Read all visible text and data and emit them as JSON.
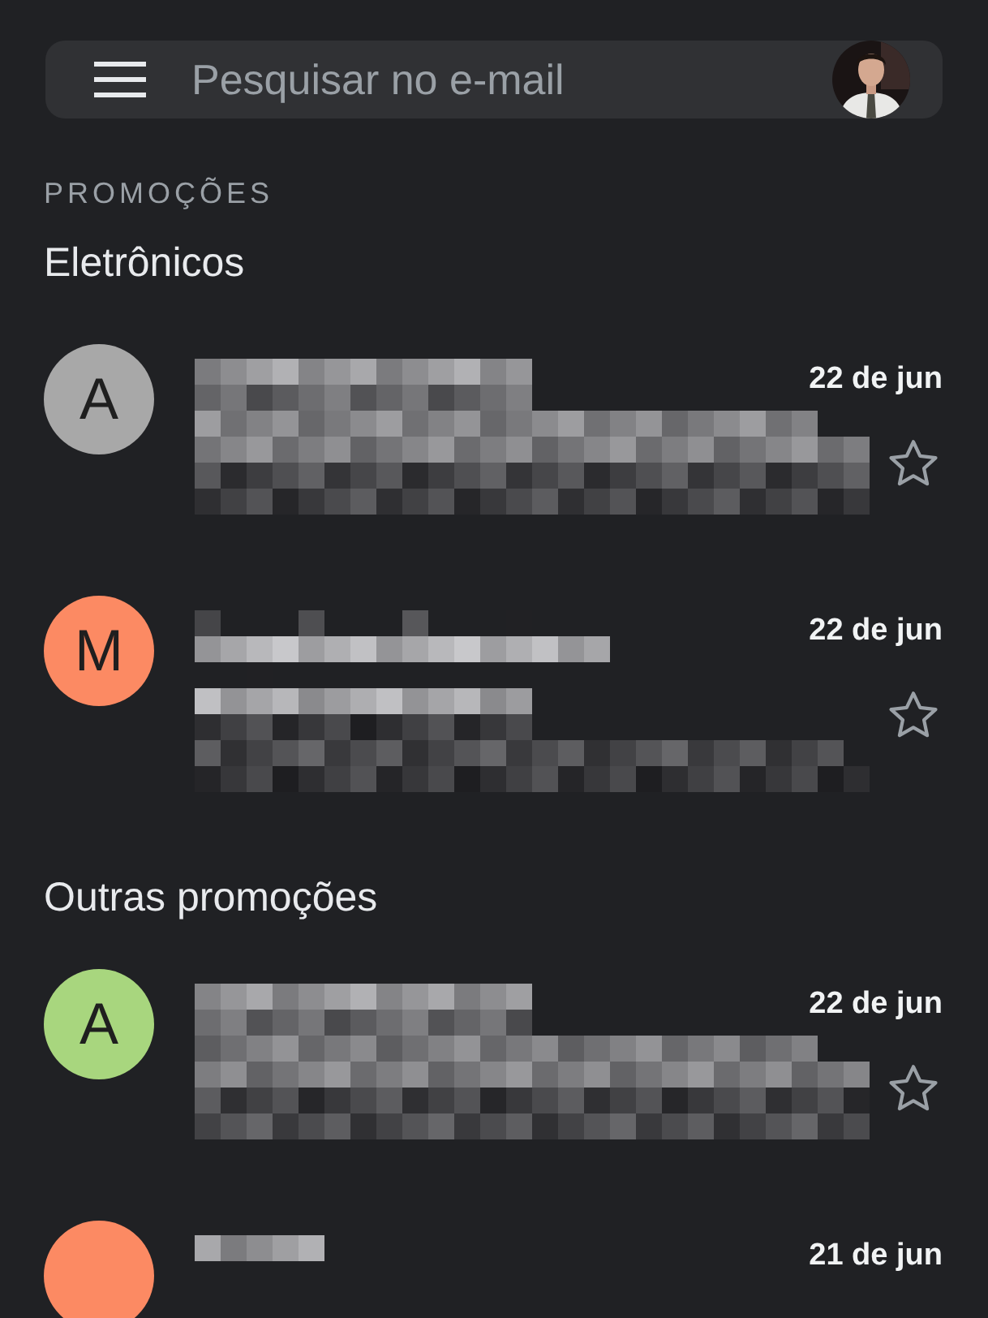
{
  "search": {
    "placeholder": "Pesquisar no e-mail"
  },
  "category_label": "PROMOÇÕES",
  "sections": [
    {
      "title": "Eletrônicos",
      "messages": [
        {
          "avatar_letter": "A",
          "color": "#a8a8a8",
          "date": "22 de jun",
          "starred": false
        },
        {
          "avatar_letter": "M",
          "color": "#fc8a63",
          "date": "22 de jun",
          "starred": false
        }
      ]
    },
    {
      "title": "Outras promoções",
      "messages": [
        {
          "avatar_letter": "A",
          "color": "#a8d67e",
          "date": "22 de jun",
          "starred": false
        },
        {
          "color": "#fc8a63",
          "date": "21 de jun"
        }
      ]
    }
  ]
}
